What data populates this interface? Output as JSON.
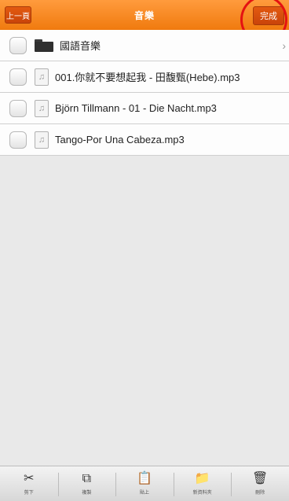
{
  "header": {
    "title": "音樂",
    "back_label": "上一頁",
    "done_label": "完成"
  },
  "list": {
    "items": [
      {
        "type": "folder",
        "name": "國語音樂"
      },
      {
        "type": "file",
        "name": "001.你就不要想起我 - 田馥甄(Hebe).mp3"
      },
      {
        "type": "file",
        "name": "Björn Tillmann - 01 - Die Nacht.mp3"
      },
      {
        "type": "file",
        "name": "Tango-Por Una Cabeza.mp3"
      }
    ]
  },
  "toolbar": {
    "items": [
      {
        "icon": "scissors-icon",
        "glyph": "✂",
        "label": "剪下"
      },
      {
        "icon": "copy-icon",
        "glyph": "⧉",
        "label": "複製"
      },
      {
        "icon": "paste-icon",
        "glyph": "📋",
        "label": "貼上"
      },
      {
        "icon": "new-folder-icon",
        "glyph": "📁",
        "label": "新資料夾"
      },
      {
        "icon": "trash-icon",
        "glyph": "🗑",
        "label": "刪除"
      }
    ]
  },
  "colors": {
    "accent": "#f07a0e",
    "highlight": "#e41212"
  }
}
